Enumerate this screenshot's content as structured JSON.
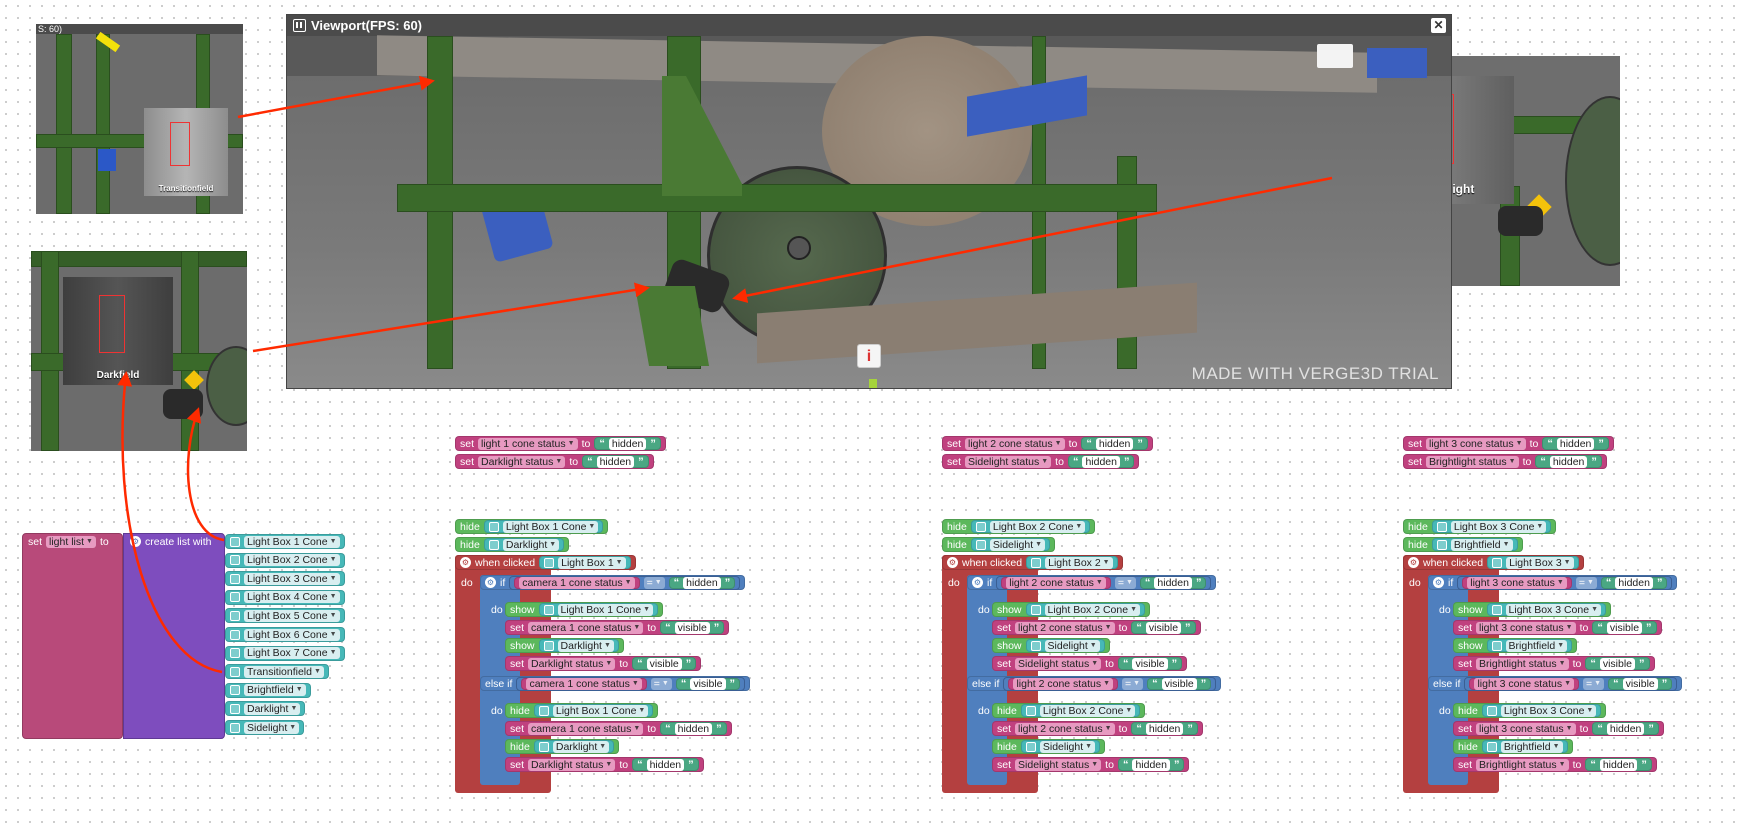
{
  "viewport": {
    "title": "Viewport(FPS: 60)",
    "close_label": "✕",
    "watermark": "MADE WITH VERGE3D TRIAL",
    "info_label": "i",
    "partial_title": "S: 60)"
  },
  "insets": {
    "transition": {
      "label": "Transitionfield"
    },
    "dark": {
      "label": "Darkfield"
    },
    "side": {
      "label": "Sidelight"
    }
  },
  "list_block": {
    "set": "set",
    "var": "light list",
    "to": "to",
    "create": "create list with",
    "items": [
      "Light Box 1 Cone",
      "Light Box 2 Cone",
      "Light Box 3 Cone",
      "Light Box 4 Cone",
      "Light Box 5 Cone",
      "Light Box 6 Cone",
      "Light Box 7 Cone",
      "Transitionfield",
      "Brightfield",
      "Darklight",
      "Sidelight"
    ]
  },
  "columns": [
    {
      "set1_var": "light 1 cone status",
      "set2_var": "Darklight status",
      "init_val": "hidden",
      "cone": "Light Box 1 Cone",
      "field": "Darklight",
      "box": "Light Box 1",
      "cond_var": "camera 1 cone status",
      "cond_val1": "hidden",
      "cond_val2": "visible",
      "show_cone": "Light Box 1 Cone",
      "set_cone_var": "camera 1 cone status",
      "vis": "visible",
      "show_field": "Darklight",
      "set_field_var": "Darklight status",
      "hide_cone": "Light Box 1 Cone",
      "set_cone_var2": "camera 1 cone status",
      "hid": "hidden",
      "hide_field": "Darklight",
      "set_field_var2": "Darklight status"
    },
    {
      "set1_var": "light 2 cone status",
      "set2_var": "Sidelight status",
      "init_val": "hidden",
      "cone": "Light Box 2 Cone",
      "field": "Sidelight",
      "box": "Light Box 2",
      "cond_var": "light 2 cone status",
      "cond_val1": "hidden",
      "cond_val2": "visible",
      "show_cone": "Light Box 2 Cone",
      "set_cone_var": "light 2 cone status",
      "vis": "visible",
      "show_field": "Sidelight",
      "set_field_var": "Sidelight status",
      "hide_cone": "Light Box 2 Cone",
      "set_cone_var2": "light 2 cone status",
      "hid": "hidden",
      "hide_field": "Sidelight",
      "set_field_var2": "Sidelight status"
    },
    {
      "set1_var": "light 3 cone status",
      "set2_var": "Brightlight status",
      "init_val": "hidden",
      "cone": "Light Box 3 Cone",
      "field": "Brightfield",
      "box": "Light Box 3",
      "cond_var": "light 3 cone status",
      "cond_val1": "hidden",
      "cond_val2": "visible",
      "show_cone": "Light Box 3 Cone",
      "set_cone_var": "light 3 cone status",
      "vis": "visible",
      "show_field": "Brightfield",
      "set_field_var": "Brightlight status",
      "hide_cone": "Light Box 3 Cone",
      "set_cone_var2": "light 3 cone status",
      "hid": "hidden",
      "hide_field": "Brightfield",
      "set_field_var2": "Brightlight status"
    }
  ],
  "keywords": {
    "set": "set",
    "to": "to",
    "hide": "hide",
    "show": "show",
    "when_clicked": "when clicked",
    "do": "do",
    "if": "if",
    "else_if": "else if",
    "eq": "="
  },
  "colors": {
    "arrow": "#ff2a00",
    "set": "#c0417f",
    "show": "#5cb85c",
    "text": "#4aa783",
    "object": "#46b8b8",
    "list": "#7e4dbe",
    "if": "#4f7fbe",
    "event": "#b44040"
  }
}
